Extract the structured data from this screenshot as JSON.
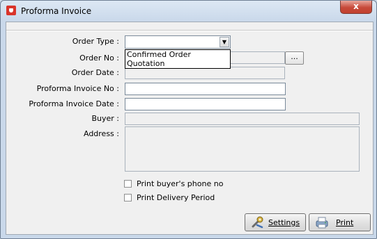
{
  "window": {
    "title": "Proforma Invoice",
    "close_glyph": "x"
  },
  "form": {
    "order_type": {
      "label": "Order Type :",
      "value": ""
    },
    "order_type_options": [
      "Confirmed Order",
      "Quotation"
    ],
    "order_no": {
      "label": "Order No :",
      "value": "",
      "browse_label": "..."
    },
    "order_date": {
      "label": "Order Date :",
      "value": ""
    },
    "proforma_invoice_no": {
      "label": "Proforma Invoice No :",
      "value": ""
    },
    "proforma_invoice_date": {
      "label": "Proforma Invoice Date :",
      "value": ""
    },
    "buyer": {
      "label": "Buyer :",
      "value": ""
    },
    "address": {
      "label": "Address :",
      "value": ""
    }
  },
  "options": {
    "print_phone": {
      "label": "Print buyer's phone no",
      "checked": false
    },
    "print_delivery": {
      "label": "Print Delivery Period",
      "checked": false
    }
  },
  "buttons": {
    "settings": {
      "label": "Settings",
      "icon": "wrench-icon"
    },
    "print": {
      "label": "Print",
      "icon": "printer-icon"
    }
  },
  "colors": {
    "close_button": "#c74a3a",
    "app_icon": "#d9342b",
    "client_bg": "#f0f0f0"
  }
}
